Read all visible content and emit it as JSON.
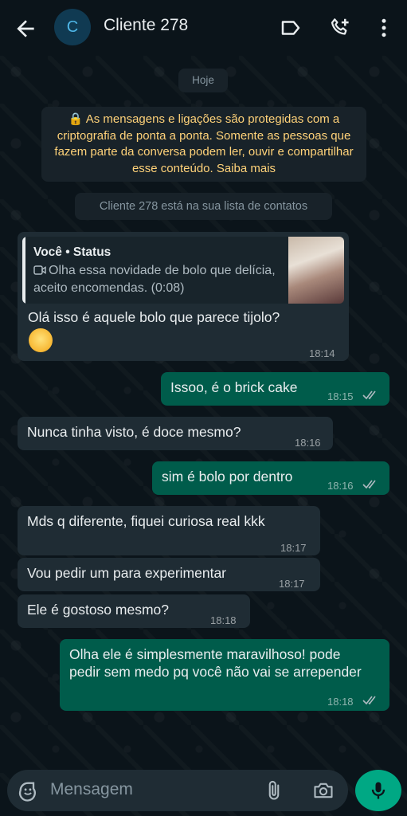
{
  "header": {
    "avatar_letter": "C",
    "title": "Cliente 278",
    "icons": [
      "back-arrow-icon",
      "label-icon",
      "add-call-icon",
      "more-vert-icon"
    ]
  },
  "chat": {
    "day_label": "Hoje",
    "encryption_notice": "🔒 As mensagens e ligações são protegidas com a criptografia de ponta a ponta. Somente as pessoas que fazem parte da conversa podem ler, ouvir e compartilhar esse conteúdo. Saiba mais",
    "contact_notice": "Cliente 278 está na sua lista de contatos",
    "quoted": {
      "author": "Você • Status",
      "text": "Olha essa novidade de bolo que delícia, aceito encomendas. (0:08)"
    },
    "messages": [
      {
        "dir": "in",
        "text": "Olá isso é aquele bolo que parece tijolo?",
        "emoji": "😅",
        "time": "18:14"
      },
      {
        "dir": "out",
        "text": "Issoo, é o brick cake",
        "time": "18:15"
      },
      {
        "dir": "in",
        "text": "Nunca tinha visto, é doce mesmo?",
        "time": "18:16"
      },
      {
        "dir": "out",
        "text": "sim é bolo por dentro",
        "time": "18:16"
      },
      {
        "dir": "in",
        "text": "Mds q diferente, fiquei curiosa real kkk",
        "time": "18:17"
      },
      {
        "dir": "in",
        "text": "Vou pedir um para experimentar",
        "time": "18:17"
      },
      {
        "dir": "in",
        "text": "Ele é gostoso mesmo?",
        "time": "18:18"
      },
      {
        "dir": "out",
        "text": "Olha ele é simplesmente maravilhoso! pode pedir sem medo pq você não vai se arrepender",
        "time": "18:18"
      }
    ]
  },
  "composer": {
    "placeholder": "Mensagem",
    "icons": [
      "sticker-icon",
      "attach-icon",
      "camera-icon",
      "mic-icon"
    ]
  },
  "colors": {
    "background": "#0b141a",
    "incoming_bubble": "#1f2c34",
    "outgoing_bubble": "#005c4b",
    "accent": "#00a884",
    "notice_text": "#ffd279"
  }
}
